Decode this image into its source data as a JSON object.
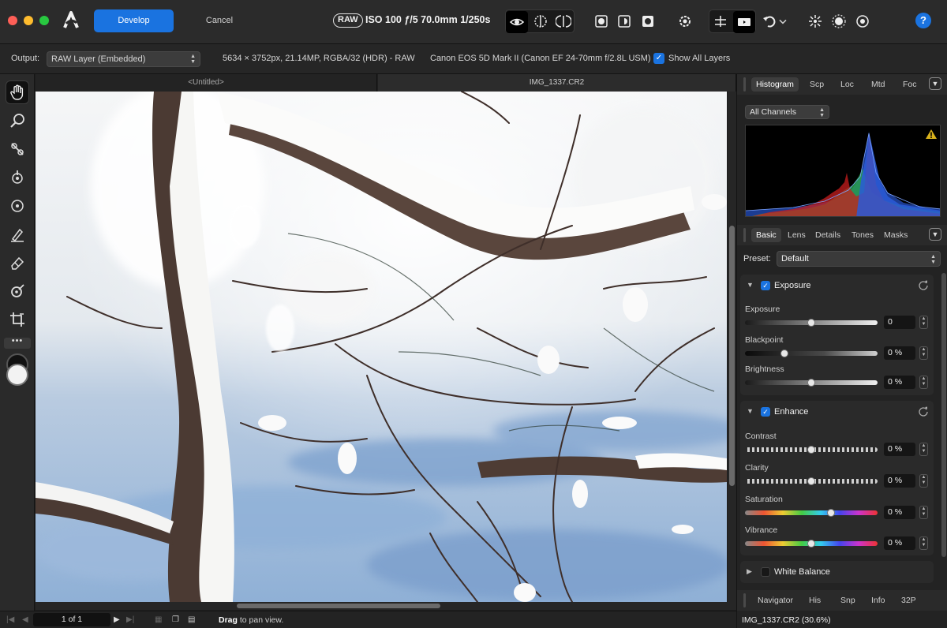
{
  "toolbar": {
    "develop_label": "Develop",
    "cancel_label": "Cancel",
    "raw_badge": "RAW",
    "exif": "ISO 100 ƒ/5 70.0mm 1/250s",
    "help_label": "?"
  },
  "context": {
    "output_label": "Output:",
    "output_value": "RAW Layer (Embedded)",
    "image_info": "5634 × 3752px, 21.14MP, RGBA/32 (HDR) - RAW",
    "camera_info": "Canon EOS 5D Mark II (Canon EF 24-70mm f/2.8L USM)",
    "show_all_layers_label": "Show All Layers",
    "show_all_layers_checked": true
  },
  "tools": {
    "more_label": "•••"
  },
  "document_tabs": [
    {
      "label": "<Untitled>"
    },
    {
      "label": "IMG_1337.CR2"
    }
  ],
  "status": {
    "page": "1 of 1",
    "hint_bold": "Drag",
    "hint_rest": " to pan view."
  },
  "studio_top": {
    "tabs": [
      "Histogram",
      "Scp",
      "Loc",
      "Mtd",
      "Foc"
    ],
    "channel": "All Channels"
  },
  "studio_mid": {
    "tabs": [
      "Basic",
      "Lens",
      "Details",
      "Tones",
      "Masks"
    ]
  },
  "preset": {
    "label": "Preset:",
    "value": "Default"
  },
  "exposure_group": {
    "title": "Exposure",
    "enabled": true,
    "sliders": [
      {
        "label": "Exposure",
        "value": "0",
        "position": 0.5
      },
      {
        "label": "Blackpoint",
        "value": "0 %",
        "position": 0.3
      },
      {
        "label": "Brightness",
        "value": "0 %",
        "position": 0.5
      }
    ]
  },
  "enhance_group": {
    "title": "Enhance",
    "enabled": true,
    "sliders": [
      {
        "label": "Contrast",
        "value": "0 %",
        "position": 0.5
      },
      {
        "label": "Clarity",
        "value": "0 %",
        "position": 0.5
      },
      {
        "label": "Saturation",
        "value": "0 %",
        "position": 0.65
      },
      {
        "label": "Vibrance",
        "value": "0 %",
        "position": 0.5
      }
    ]
  },
  "white_balance_group": {
    "title": "White Balance",
    "enabled": false
  },
  "studio_bottom": {
    "tabs": [
      "Navigator",
      "His",
      "Snp",
      "Info",
      "32P"
    ],
    "file_title": "IMG_1337.CR2 (30.6%)"
  },
  "colors": {
    "accent": "#1a73e0",
    "panel_bg": "#232323",
    "toolbar_bg": "#2b2b2b"
  }
}
